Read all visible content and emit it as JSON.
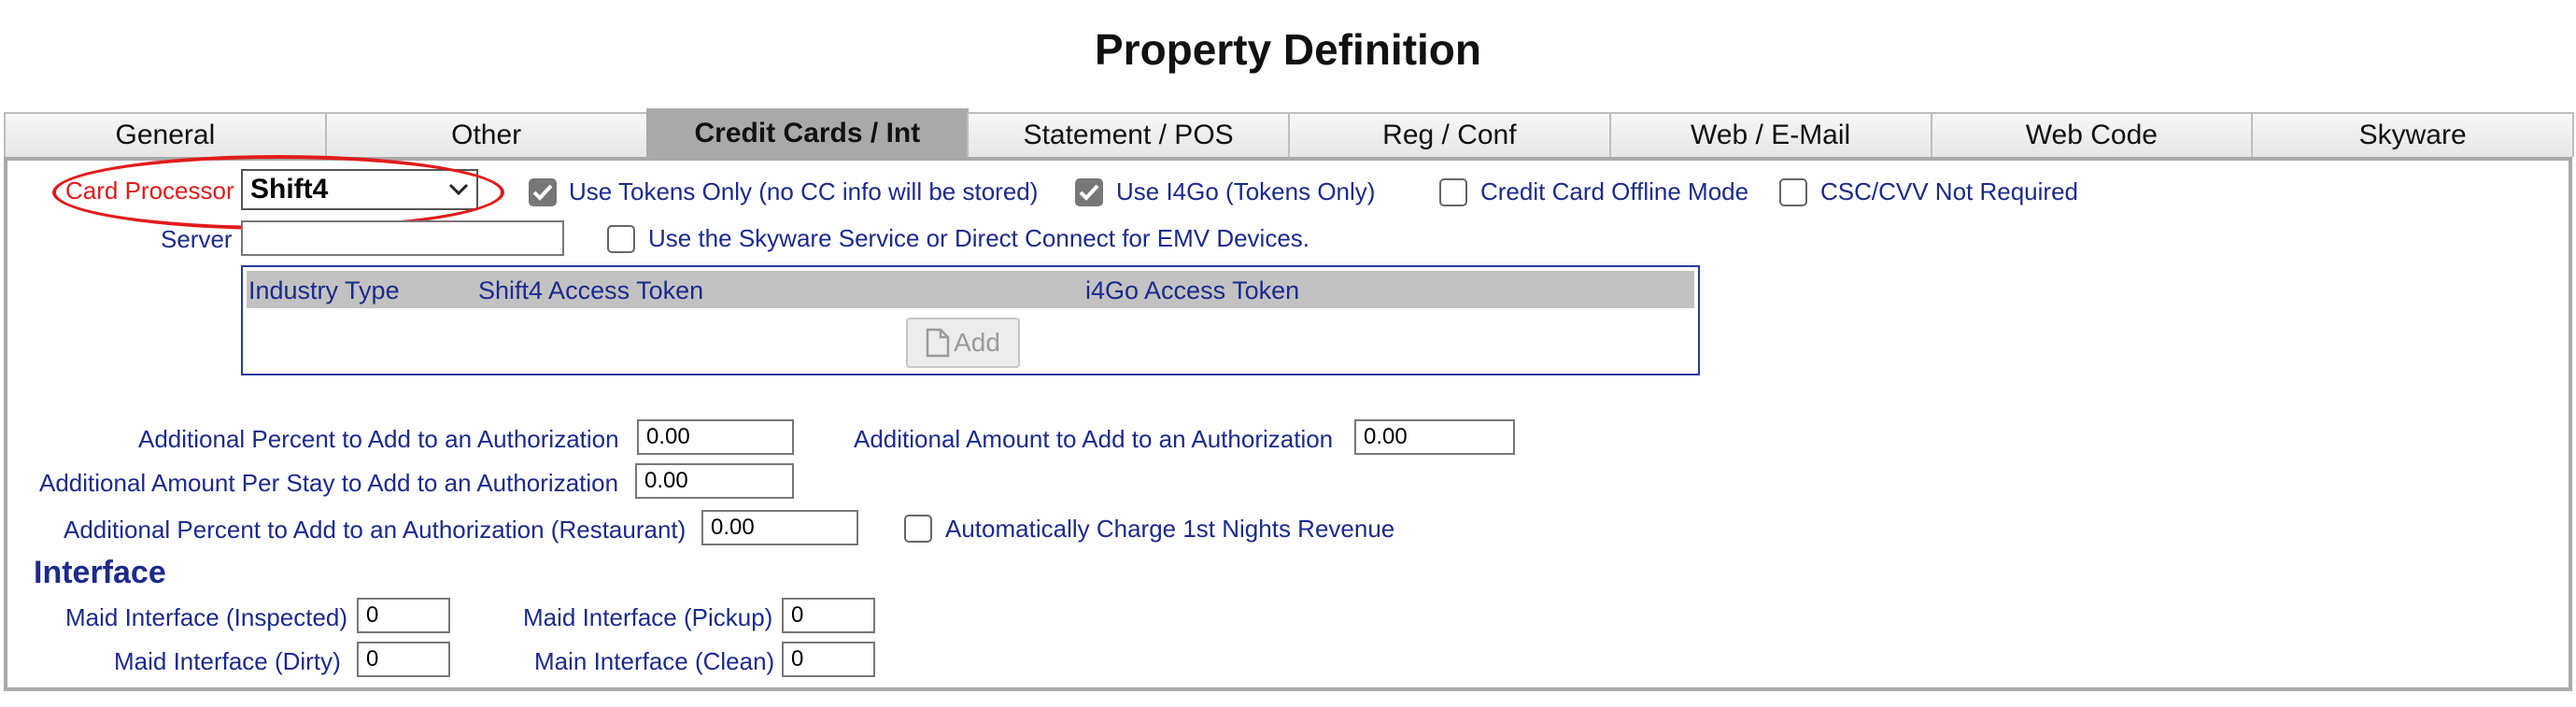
{
  "page": {
    "title": "Property Definition"
  },
  "tabs": [
    {
      "label": "General"
    },
    {
      "label": "Other"
    },
    {
      "label": "Credit Cards / Int",
      "active": true
    },
    {
      "label": "Statement / POS"
    },
    {
      "label": "Reg / Conf"
    },
    {
      "label": "Web / E-Mail"
    },
    {
      "label": "Web Code"
    },
    {
      "label": "Skyware"
    }
  ],
  "card_processor": {
    "label": "Card Processor",
    "value": "Shift4"
  },
  "options": {
    "use_tokens_only": {
      "label": "Use Tokens Only (no CC info will be stored)",
      "checked": true
    },
    "use_i4go": {
      "label": "Use I4Go (Tokens Only)",
      "checked": true
    },
    "offline_mode": {
      "label": "Credit Card Offline Mode",
      "checked": false
    },
    "csc_not_required": {
      "label": "CSC/CVV Not Required",
      "checked": false
    },
    "skyware_service": {
      "label": "Use the Skyware Service or Direct Connect for EMV Devices.",
      "checked": false
    },
    "auto_charge": {
      "label": "Automatically Charge 1st Nights Revenue",
      "checked": false
    }
  },
  "server": {
    "label": "Server",
    "value": ""
  },
  "token_table": {
    "columns": [
      "Industry Type",
      "Shift4 Access Token",
      "i4Go Access Token"
    ],
    "add_label": "Add"
  },
  "authorization": {
    "percent": {
      "label": "Additional Percent to Add to an Authorization",
      "value": "0.00"
    },
    "amount": {
      "label": "Additional Amount to Add to an Authorization",
      "value": "0.00"
    },
    "per_stay": {
      "label": "Additional Amount Per Stay to Add to an Authorization",
      "value": "0.00"
    },
    "restaurant": {
      "label": "Additional Percent to Add to an Authorization (Restaurant)",
      "value": "0.00"
    }
  },
  "interface": {
    "title": "Interface",
    "inspected": {
      "label": "Maid Interface (Inspected)",
      "value": "0"
    },
    "pickup": {
      "label": "Maid Interface (Pickup)",
      "value": "0"
    },
    "dirty": {
      "label": "Maid Interface (Dirty)",
      "value": "0"
    },
    "clean": {
      "label": "Main Interface (Clean)",
      "value": "0"
    }
  },
  "colors": {
    "label_blue": "#1c2a8c",
    "highlight_red": "#e11b1b",
    "active_tab": "#a9a9a9"
  }
}
